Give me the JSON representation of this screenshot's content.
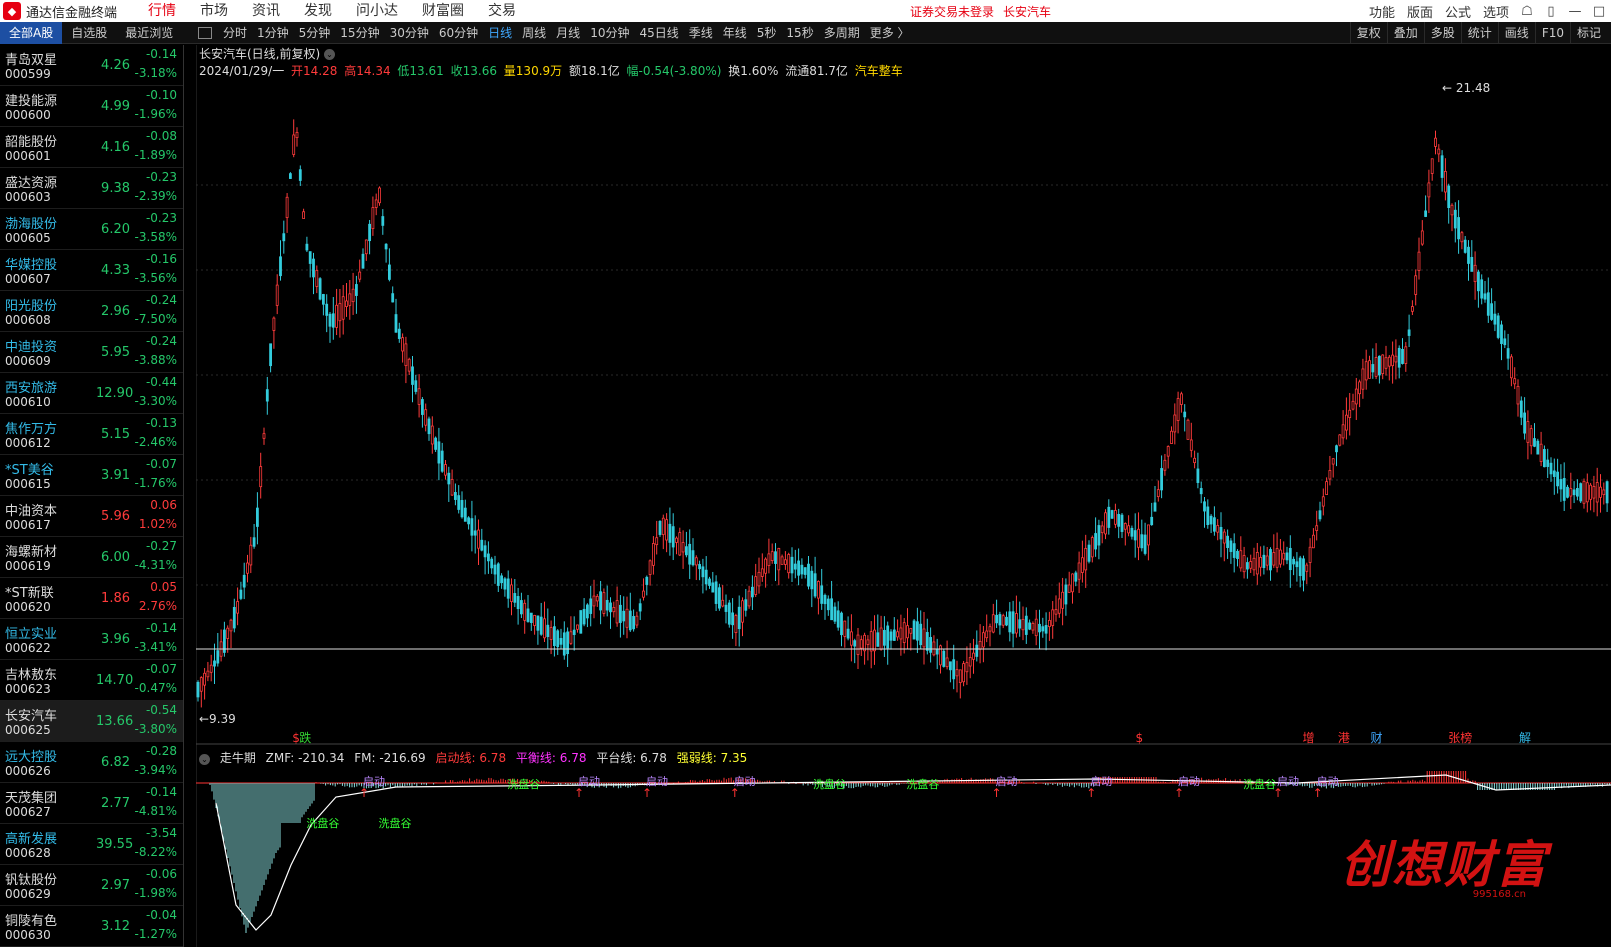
{
  "app": {
    "title": "通达信金融终端",
    "login_status": "证券交易未登录",
    "current_stock": "长安汽车"
  },
  "top_menu": [
    "行情",
    "市场",
    "资讯",
    "发现",
    "问小达",
    "财富圈",
    "交易"
  ],
  "right_menu": [
    "功能",
    "版面",
    "公式",
    "选项"
  ],
  "list_tabs": [
    "全部A股",
    "自选股",
    "最近浏览"
  ],
  "periods": [
    "分时",
    "1分钟",
    "5分钟",
    "15分钟",
    "30分钟",
    "60分钟",
    "日线",
    "周线",
    "月线",
    "10分钟",
    "45日线",
    "季线",
    "年线",
    "5秒",
    "15秒",
    "多周期",
    "更多 〉"
  ],
  "active_period": "日线",
  "tools": [
    "复权",
    "叠加",
    "多股",
    "统计",
    "画线",
    "F10",
    "标记"
  ],
  "stocks": [
    {
      "name": "青岛双星",
      "code": "000599",
      "price": "4.26",
      "change": "-0.14",
      "pct": "-3.18%",
      "dir": "down",
      "cyan": false
    },
    {
      "name": "建投能源",
      "code": "000600",
      "price": "4.99",
      "change": "-0.10",
      "pct": "-1.96%",
      "dir": "down",
      "cyan": false
    },
    {
      "name": "韶能股份",
      "code": "000601",
      "price": "4.16",
      "change": "-0.08",
      "pct": "-1.89%",
      "dir": "down",
      "cyan": false
    },
    {
      "name": "盛达资源",
      "code": "000603",
      "price": "9.38",
      "change": "-0.23",
      "pct": "-2.39%",
      "dir": "down",
      "cyan": false
    },
    {
      "name": "渤海股份",
      "code": "000605",
      "price": "6.20",
      "change": "-0.23",
      "pct": "-3.58%",
      "dir": "down",
      "cyan": true
    },
    {
      "name": "华媒控股",
      "code": "000607",
      "price": "4.33",
      "change": "-0.16",
      "pct": "-3.56%",
      "dir": "down",
      "cyan": true
    },
    {
      "name": "阳光股份",
      "code": "000608",
      "price": "2.96",
      "change": "-0.24",
      "pct": "-7.50%",
      "dir": "down",
      "cyan": true
    },
    {
      "name": "中迪投资",
      "code": "000609",
      "price": "5.95",
      "change": "-0.24",
      "pct": "-3.88%",
      "dir": "down",
      "cyan": true
    },
    {
      "name": "西安旅游",
      "code": "000610",
      "price": "12.90",
      "change": "-0.44",
      "pct": "-3.30%",
      "dir": "down",
      "cyan": true
    },
    {
      "name": "焦作万方",
      "code": "000612",
      "price": "5.15",
      "change": "-0.13",
      "pct": "-2.46%",
      "dir": "down",
      "cyan": true
    },
    {
      "name": "*ST美谷",
      "code": "000615",
      "price": "3.91",
      "change": "-0.07",
      "pct": "-1.76%",
      "dir": "down",
      "cyan": true
    },
    {
      "name": "中油资本",
      "code": "000617",
      "price": "5.96",
      "change": "0.06",
      "pct": "1.02%",
      "dir": "up",
      "cyan": false
    },
    {
      "name": "海螺新材",
      "code": "000619",
      "price": "6.00",
      "change": "-0.27",
      "pct": "-4.31%",
      "dir": "down",
      "cyan": false
    },
    {
      "name": "*ST新联",
      "code": "000620",
      "price": "1.86",
      "change": "0.05",
      "pct": "2.76%",
      "dir": "up",
      "cyan": false
    },
    {
      "name": "恒立实业",
      "code": "000622",
      "price": "3.96",
      "change": "-0.14",
      "pct": "-3.41%",
      "dir": "down",
      "cyan": true
    },
    {
      "name": "吉林敖东",
      "code": "000623",
      "price": "14.70",
      "change": "-0.07",
      "pct": "-0.47%",
      "dir": "down",
      "cyan": false
    },
    {
      "name": "长安汽车",
      "code": "000625",
      "price": "13.66",
      "change": "-0.54",
      "pct": "-3.80%",
      "dir": "down",
      "cyan": false
    },
    {
      "name": "远大控股",
      "code": "000626",
      "price": "6.82",
      "change": "-0.28",
      "pct": "-3.94%",
      "dir": "down",
      "cyan": true
    },
    {
      "name": "天茂集团",
      "code": "000627",
      "price": "2.77",
      "change": "-0.14",
      "pct": "-4.81%",
      "dir": "down",
      "cyan": false
    },
    {
      "name": "高新发展",
      "code": "000628",
      "price": "39.55",
      "change": "-3.54",
      "pct": "-8.22%",
      "dir": "down",
      "cyan": true
    },
    {
      "name": "钒钛股份",
      "code": "000629",
      "price": "2.97",
      "change": "-0.06",
      "pct": "-1.98%",
      "dir": "down",
      "cyan": false
    },
    {
      "name": "铜陵有色",
      "code": "000630",
      "price": "3.12",
      "change": "-0.04",
      "pct": "-1.27%",
      "dir": "down",
      "cyan": false
    }
  ],
  "selected_stock_index": 16,
  "chart": {
    "title": "长安汽车(日线,前复权)",
    "date": "2024/01/29/一",
    "open": "开14.28",
    "high": "高14.34",
    "low": "低13.61",
    "close": "收13.66",
    "volume": "量130.9万",
    "amount": "额18.1亿",
    "range": "幅-0.54(-3.80%)",
    "turnover": "换1.60%",
    "float": "流通81.7亿",
    "sector": "汽车整车",
    "max_label": "21.48",
    "min_label": "9.39",
    "price_max": 21.48,
    "price_min": 9.39
  },
  "event_markers": [
    {
      "text": "跌",
      "color": "#33d633",
      "at": 0.073
    },
    {
      "text": "$",
      "color": "#ff3333",
      "at": 0.068
    },
    {
      "text": "$",
      "color": "#ff3333",
      "at": 0.664
    },
    {
      "text": "增",
      "color": "#ff3333",
      "at": 0.782
    },
    {
      "text": "港",
      "color": "#ff3333",
      "at": 0.807
    },
    {
      "text": "财",
      "color": "#3fa8ff",
      "at": 0.83
    },
    {
      "text": "张榜",
      "color": "#ff3333",
      "at": 0.885
    },
    {
      "text": "解",
      "color": "#33bbe8",
      "at": 0.935
    }
  ],
  "indicator": {
    "name": "走牛期",
    "zmf": "ZMF: -210.34",
    "fm": "FM: -216.69",
    "qidong": "启动线: 6.78",
    "pingheng": "平衡线: 6.78",
    "pingtai": "平台线: 6.78",
    "qiangruo": "强弱线: 7.35",
    "labels": [
      {
        "text": "启动",
        "color": "#bb88ff",
        "at": 0.118
      },
      {
        "text": "洗盘谷",
        "color": "#33ff33",
        "at": 0.078
      },
      {
        "text": "洗盘谷",
        "color": "#33ff33",
        "at": 0.129
      },
      {
        "text": "洗盘谷",
        "color": "#33ff33",
        "at": 0.22
      },
      {
        "text": "启动",
        "color": "#bb88ff",
        "at": 0.27
      },
      {
        "text": "启动",
        "color": "#bb88ff",
        "at": 0.318
      },
      {
        "text": "启动",
        "color": "#bb88ff",
        "at": 0.38
      },
      {
        "text": "洗盘谷",
        "color": "#33ff33",
        "at": 0.436
      },
      {
        "text": "洗盘谷",
        "color": "#33ff33",
        "at": 0.502
      },
      {
        "text": "启动",
        "color": "#bb88ff",
        "at": 0.565
      },
      {
        "text": "启动",
        "color": "#bb88ff",
        "at": 0.632
      },
      {
        "text": "启动",
        "color": "#bb88ff",
        "at": 0.694
      },
      {
        "text": "洗盘谷",
        "color": "#33ff33",
        "at": 0.74
      },
      {
        "text": "启动",
        "color": "#bb88ff",
        "at": 0.764
      },
      {
        "text": "启动",
        "color": "#bb88ff",
        "at": 0.792
      }
    ]
  },
  "watermark": {
    "text": "创想财富",
    "url": "995168.cn"
  },
  "colors": {
    "up": "#ff3b3b",
    "down": "#33ccdd",
    "ma": "#ffffff"
  }
}
